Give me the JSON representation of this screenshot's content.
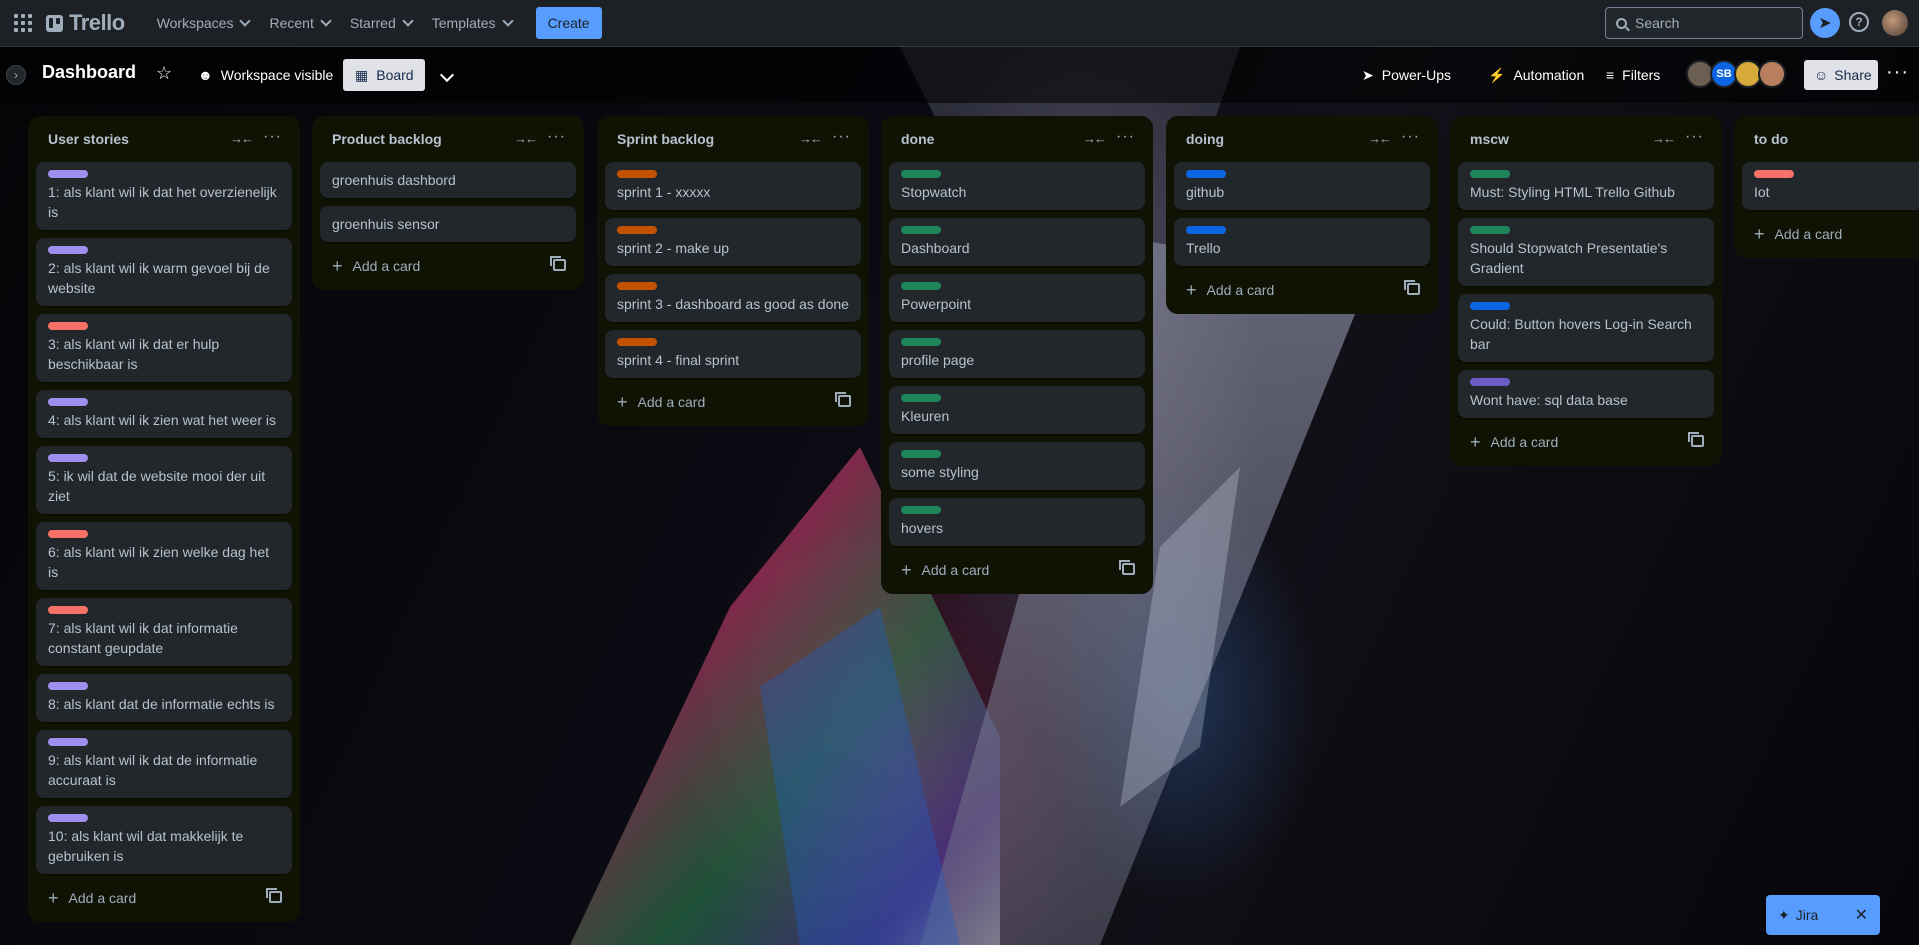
{
  "topnav": {
    "logo": "Trello",
    "menus": [
      "Workspaces",
      "Recent",
      "Starred",
      "Templates"
    ],
    "create": "Create",
    "search_placeholder": "Search"
  },
  "board": {
    "title": "Dashboard",
    "visibility": "Workspace visible",
    "view": "Board",
    "powerups": "Power-Ups",
    "automation": "Automation",
    "filters": "Filters",
    "share": "Share",
    "members": [
      {
        "initials": "",
        "color": "#6b5e52"
      },
      {
        "initials": "SB",
        "color": "#0c66e4"
      },
      {
        "initials": "",
        "color": "#d6a93a"
      },
      {
        "initials": "",
        "color": "#b77f5e"
      }
    ]
  },
  "labels": {
    "purple": "#9f8fef",
    "red": "#f87168",
    "orange": "#c25100",
    "green": "#1f845a",
    "blue": "#0c66e4",
    "violet": "#6e5dc6"
  },
  "lists": [
    {
      "title": "User stories",
      "cards": [
        {
          "text": "1: als klant wil ik dat het overzienelijk is",
          "label": "purple"
        },
        {
          "text": "2: als klant wil ik warm gevoel bij de website",
          "label": "purple"
        },
        {
          "text": "3: als klant wil ik dat er hulp beschikbaar is",
          "label": "red"
        },
        {
          "text": "4: als klant wil ik zien wat het weer is",
          "label": "purple"
        },
        {
          "text": "5: ik wil dat de website mooi der uit ziet",
          "label": "purple"
        },
        {
          "text": "6: als klant wil ik zien welke dag het is",
          "label": "red"
        },
        {
          "text": "7: als klant wil ik dat informatie constant geupdate",
          "label": "red"
        },
        {
          "text": "8: als klant dat de informatie echts is",
          "label": "purple"
        },
        {
          "text": "9: als klant wil ik dat de informatie accuraat is",
          "label": "purple"
        },
        {
          "text": "10: als klant wil dat makkelijk te gebruiken is",
          "label": "purple"
        }
      ],
      "add": "Add a card"
    },
    {
      "title": "Product backlog",
      "cards": [
        {
          "text": "groenhuis dashbord",
          "label": ""
        },
        {
          "text": "groenhuis sensor",
          "label": ""
        }
      ],
      "add": "Add a card"
    },
    {
      "title": "Sprint backlog",
      "cards": [
        {
          "text": "sprint 1 - xxxxx",
          "label": "orange"
        },
        {
          "text": "sprint 2 - make up",
          "label": "orange"
        },
        {
          "text": "sprint 3 - dashboard as good as done",
          "label": "orange"
        },
        {
          "text": "sprint 4 - final sprint",
          "label": "orange"
        }
      ],
      "add": "Add a card"
    },
    {
      "title": "done",
      "cards": [
        {
          "text": "Stopwatch",
          "label": "green"
        },
        {
          "text": "Dashboard",
          "label": "green"
        },
        {
          "text": "Powerpoint",
          "label": "green"
        },
        {
          "text": "profile page",
          "label": "green"
        },
        {
          "text": "Kleuren",
          "label": "green"
        },
        {
          "text": "some styling",
          "label": "green"
        },
        {
          "text": "hovers",
          "label": "green"
        }
      ],
      "add": "Add a card"
    },
    {
      "title": "doing",
      "cards": [
        {
          "text": "github",
          "label": "blue"
        },
        {
          "text": "Trello",
          "label": "blue"
        }
      ],
      "add": "Add a card"
    },
    {
      "title": "mscw",
      "cards": [
        {
          "text": "Must: Styling HTML Trello Github",
          "label": "green"
        },
        {
          "text": "Should Stopwatch Presentatie's Gradient",
          "label": "green"
        },
        {
          "text": "Could: Button hovers Log-in Search bar",
          "label": "blue"
        },
        {
          "text": "Wont have: sql data base",
          "label": "violet"
        }
      ],
      "add": "Add a card"
    },
    {
      "title": "to do",
      "cards": [
        {
          "text": "Iot",
          "label": "red"
        }
      ],
      "add": "Add a card"
    }
  ],
  "jira": {
    "label": "Jira"
  }
}
